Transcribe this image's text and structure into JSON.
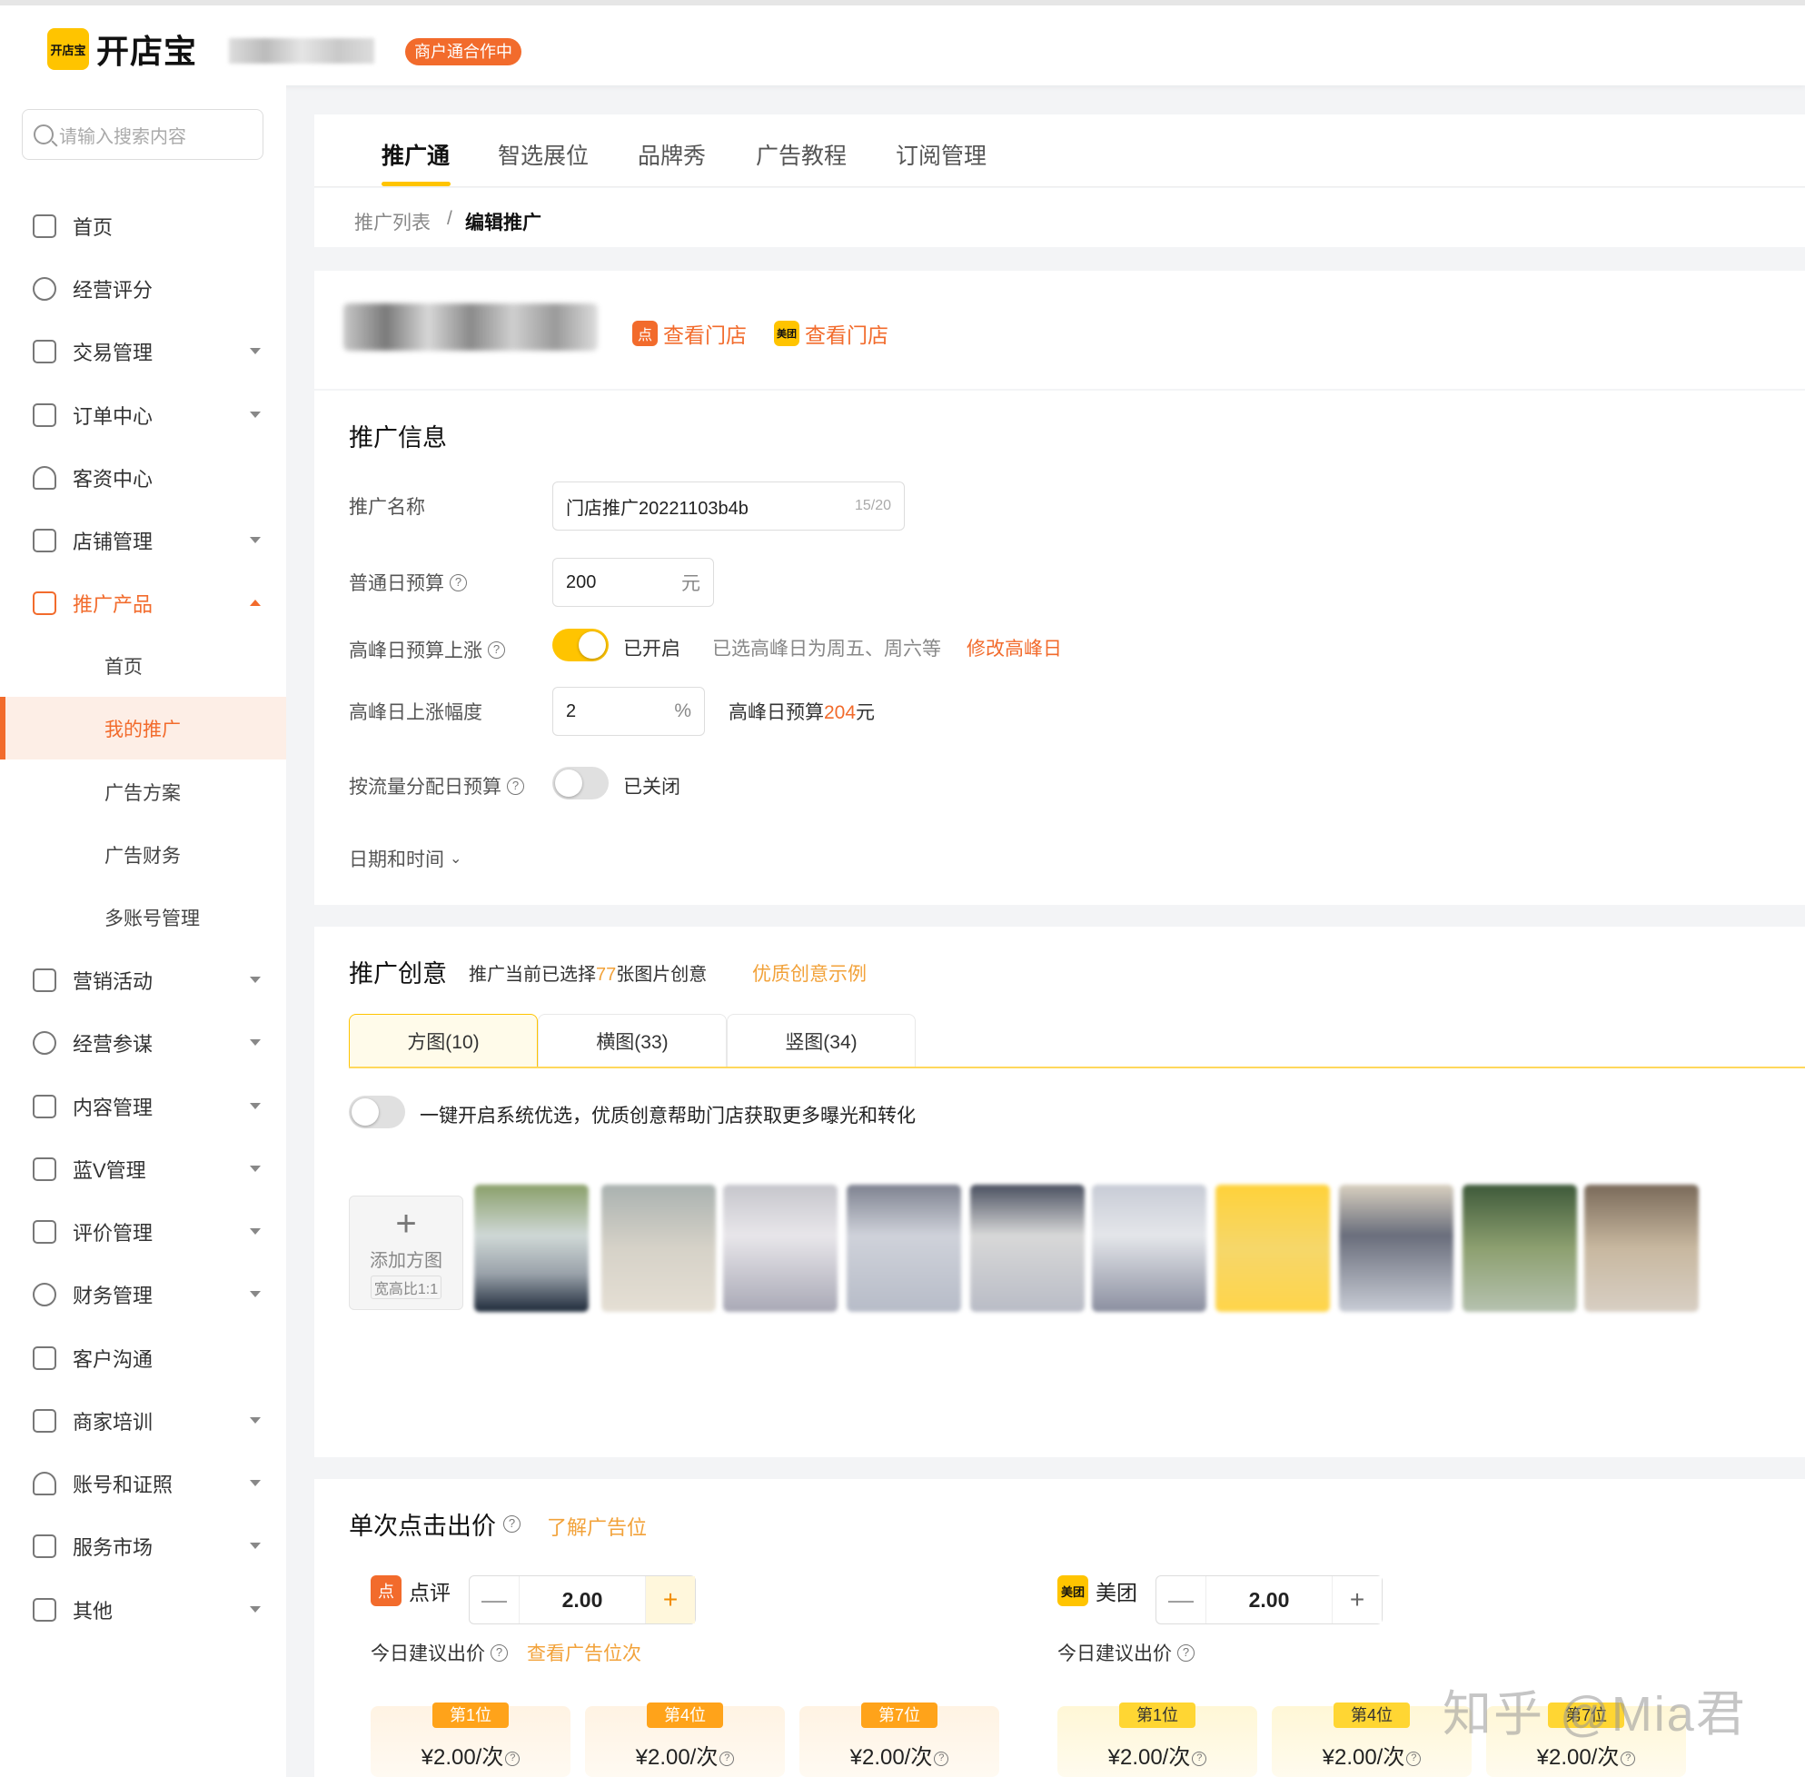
{
  "header": {
    "logo_text": "开店宝",
    "logo_mark": "开店宝",
    "merchant_badge": "商户通合作中"
  },
  "sidebar": {
    "search_placeholder": "请输入搜索内容",
    "items": [
      {
        "label": "首页",
        "icon": "monitor-icon"
      },
      {
        "label": "经营评分",
        "icon": "medal-icon"
      },
      {
        "label": "交易管理",
        "icon": "transaction-icon"
      },
      {
        "label": "订单中心",
        "icon": "clipboard-icon"
      },
      {
        "label": "客资中心",
        "icon": "user-icon"
      },
      {
        "label": "店铺管理",
        "icon": "store-icon"
      },
      {
        "label": "推广产品",
        "icon": "megaphone-icon"
      },
      {
        "label": "营销活动",
        "icon": "marketing-icon"
      },
      {
        "label": "经营参谋",
        "icon": "gauge-icon"
      },
      {
        "label": "内容管理",
        "icon": "content-icon"
      },
      {
        "label": "蓝V管理",
        "icon": "grid-icon"
      },
      {
        "label": "评价管理",
        "icon": "thumbs-up-icon"
      },
      {
        "label": "财务管理",
        "icon": "yen-icon"
      },
      {
        "label": "客户沟通",
        "icon": "chat-icon"
      },
      {
        "label": "商家培训",
        "icon": "graduation-icon"
      },
      {
        "label": "账号和证照",
        "icon": "account-icon"
      },
      {
        "label": "服务市场",
        "icon": "market-icon"
      },
      {
        "label": "其他",
        "icon": "more-icon"
      }
    ],
    "sub_items": [
      "首页",
      "我的推广",
      "广告方案",
      "广告财务",
      "多账号管理"
    ]
  },
  "tabs": [
    "推广通",
    "智选展位",
    "品牌秀",
    "广告教程",
    "订阅管理"
  ],
  "breadcrumb": {
    "parent": "推广列表",
    "separator": "/",
    "current": "编辑推广"
  },
  "store": {
    "dianping_link": "查看门店",
    "meituan_link": "查看门店",
    "meituan_icon_text": "美团",
    "dianping_icon_text": "点"
  },
  "promo_info": {
    "title": "推广信息",
    "name_label": "推广名称",
    "name_value": "门店推广20221103b4b",
    "name_count": "15/20",
    "budget_label": "普通日预算",
    "budget_value": "200",
    "budget_unit": "元",
    "peak_label": "高峰日预算上涨",
    "peak_state": "已开启",
    "peak_note": "已选高峰日为周五、周六等",
    "peak_edit": "修改高峰日",
    "rise_label": "高峰日上涨幅度",
    "rise_value": "2",
    "rise_unit": "%",
    "peak_budget_prefix": "高峰日预算",
    "peak_budget_value": "204",
    "peak_budget_unit": "元",
    "traffic_label": "按流量分配日预算",
    "traffic_state": "已关闭",
    "datetime_label": "日期和时间"
  },
  "creative": {
    "title": "推广创意",
    "summary_prefix": "推广当前已选择",
    "summary_count": "77",
    "summary_suffix": "张图片创意",
    "example_link": "优质创意示例",
    "tabs": [
      "方图(10)",
      "横图(33)",
      "竖图(34)"
    ],
    "auto_optimize": "一键开启系统优选，优质创意帮助门店获取更多曝光和转化",
    "add_label": "添加方图",
    "add_ratio": "宽高比1:1"
  },
  "bid": {
    "title": "单次点击出价",
    "learn_link": "了解广告位",
    "dianping": {
      "name": "点评",
      "value": "2.00",
      "suggest_label": "今日建议出价",
      "view_link": "查看广告位次"
    },
    "meituan": {
      "name": "美团",
      "value": "2.00",
      "suggest_label": "今日建议出价"
    },
    "dianping_slots": [
      {
        "tag": "第1位",
        "price": "¥2.00/次"
      },
      {
        "tag": "第4位",
        "price": "¥2.00/次"
      },
      {
        "tag": "第7位",
        "price": "¥2.00/次"
      }
    ],
    "meituan_slots": [
      {
        "tag": "第1位",
        "price": "¥2.00/次"
      },
      {
        "tag": "第4位",
        "price": "¥2.00/次"
      },
      {
        "tag": "第7位",
        "price": "¥2.00/次"
      }
    ],
    "minus": "—",
    "plus": "+"
  },
  "watermark": "知乎 @Mia君",
  "colors": {
    "brand_yellow": "#ffc400",
    "accent_orange": "#f26b2c"
  }
}
